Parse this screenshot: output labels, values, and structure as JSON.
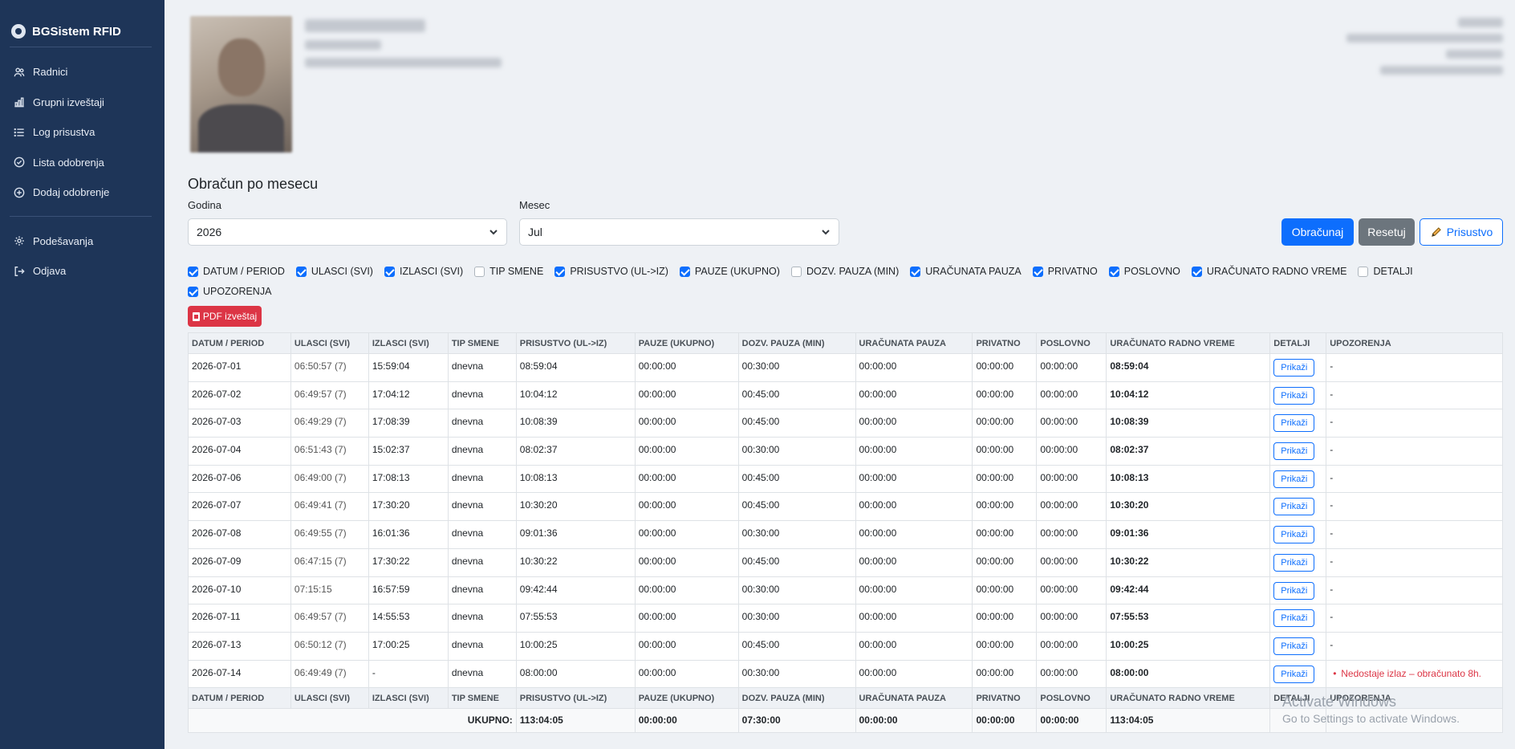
{
  "app": {
    "title": "BGSistem RFID"
  },
  "sidebar": {
    "items": [
      {
        "label": "Radnici",
        "icon": "users-icon"
      },
      {
        "label": "Grupni izveštaji",
        "icon": "bar-chart-icon"
      },
      {
        "label": "Log prisustva",
        "icon": "list-icon"
      },
      {
        "label": "Lista odobrenja",
        "icon": "check-circle-icon"
      },
      {
        "label": "Dodaj odobrenje",
        "icon": "plus-circle-icon"
      }
    ],
    "bottom_items": [
      {
        "label": "Podešavanja",
        "icon": "gear-icon"
      },
      {
        "label": "Odjava",
        "icon": "logout-icon"
      }
    ]
  },
  "section": {
    "title": "Obračun po mesecu"
  },
  "form": {
    "year_label": "Godina",
    "year_value": "2026",
    "month_label": "Mesec",
    "month_value": "Jul",
    "calculate": "Obračunaj",
    "reset": "Resetuj",
    "attendance": "Prisustvo"
  },
  "columns_toggle": [
    {
      "label": "DATUM / PERIOD",
      "checked": true
    },
    {
      "label": "ULASCI (SVI)",
      "checked": true
    },
    {
      "label": "IZLASCI (SVI)",
      "checked": true
    },
    {
      "label": "TIP SMENE",
      "checked": false
    },
    {
      "label": "PRISUSTVO (UL->IZ)",
      "checked": true
    },
    {
      "label": "PAUZE (UKUPNO)",
      "checked": true
    },
    {
      "label": "DOZV. PAUZA (MIN)",
      "checked": false
    },
    {
      "label": "URAČUNATA PAUZA",
      "checked": true
    },
    {
      "label": "PRIVATNO",
      "checked": true
    },
    {
      "label": "POSLOVNO",
      "checked": true
    },
    {
      "label": "URAČUNATO RADNO VREME",
      "checked": true
    },
    {
      "label": "DETALJI",
      "checked": false
    },
    {
      "label": "UPOZORENJA",
      "checked": true
    }
  ],
  "pdf_button": "PDF izveštaj",
  "table": {
    "headers": [
      "DATUM / PERIOD",
      "ULASCI (SVI)",
      "IZLASCI (SVI)",
      "TIP SMENE",
      "PRISUSTVO (UL->IZ)",
      "PAUZE (UKUPNO)",
      "DOZV. PAUZA (MIN)",
      "URAČUNATA PAUZA",
      "PRIVATNO",
      "POSLOVNO",
      "URAČUNATO RADNO VREME",
      "DETALJI",
      "UPOZORENJA"
    ],
    "details_label": "Prikaži",
    "rows": [
      [
        "2026-07-01",
        "06:50:57 (7)",
        "15:59:04",
        "dnevna",
        "08:59:04",
        "00:00:00",
        "00:30:00",
        "00:00:00",
        "00:00:00",
        "00:00:00",
        "08:59:04",
        "-"
      ],
      [
        "2026-07-02",
        "06:49:57 (7)",
        "17:04:12",
        "dnevna",
        "10:04:12",
        "00:00:00",
        "00:45:00",
        "00:00:00",
        "00:00:00",
        "00:00:00",
        "10:04:12",
        "-"
      ],
      [
        "2026-07-03",
        "06:49:29 (7)",
        "17:08:39",
        "dnevna",
        "10:08:39",
        "00:00:00",
        "00:45:00",
        "00:00:00",
        "00:00:00",
        "00:00:00",
        "10:08:39",
        "-"
      ],
      [
        "2026-07-04",
        "06:51:43 (7)",
        "15:02:37",
        "dnevna",
        "08:02:37",
        "00:00:00",
        "00:30:00",
        "00:00:00",
        "00:00:00",
        "00:00:00",
        "08:02:37",
        "-"
      ],
      [
        "2026-07-06",
        "06:49:00 (7)",
        "17:08:13",
        "dnevna",
        "10:08:13",
        "00:00:00",
        "00:45:00",
        "00:00:00",
        "00:00:00",
        "00:00:00",
        "10:08:13",
        "-"
      ],
      [
        "2026-07-07",
        "06:49:41 (7)",
        "17:30:20",
        "dnevna",
        "10:30:20",
        "00:00:00",
        "00:45:00",
        "00:00:00",
        "00:00:00",
        "00:00:00",
        "10:30:20",
        "-"
      ],
      [
        "2026-07-08",
        "06:49:55 (7)",
        "16:01:36",
        "dnevna",
        "09:01:36",
        "00:00:00",
        "00:30:00",
        "00:00:00",
        "00:00:00",
        "00:00:00",
        "09:01:36",
        "-"
      ],
      [
        "2026-07-09",
        "06:47:15 (7)",
        "17:30:22",
        "dnevna",
        "10:30:22",
        "00:00:00",
        "00:45:00",
        "00:00:00",
        "00:00:00",
        "00:00:00",
        "10:30:22",
        "-"
      ],
      [
        "2026-07-10",
        "07:15:15",
        "16:57:59",
        "dnevna",
        "09:42:44",
        "00:00:00",
        "00:30:00",
        "00:00:00",
        "00:00:00",
        "00:00:00",
        "09:42:44",
        "-"
      ],
      [
        "2026-07-11",
        "06:49:57 (7)",
        "14:55:53",
        "dnevna",
        "07:55:53",
        "00:00:00",
        "00:30:00",
        "00:00:00",
        "00:00:00",
        "00:00:00",
        "07:55:53",
        "-"
      ],
      [
        "2026-07-13",
        "06:50:12 (7)",
        "17:00:25",
        "dnevna",
        "10:00:25",
        "00:00:00",
        "00:45:00",
        "00:00:00",
        "00:00:00",
        "00:00:00",
        "10:00:25",
        "-"
      ],
      [
        "2026-07-14",
        "06:49:49 (7)",
        "-",
        "dnevna",
        "08:00:00",
        "00:00:00",
        "00:30:00",
        "00:00:00",
        "00:00:00",
        "00:00:00",
        "08:00:00",
        "Nedostaje izlaz – obračunato 8h."
      ]
    ],
    "total": {
      "label": "UKUPNO:",
      "values": [
        "113:04:05",
        "00:00:00",
        "07:30:00",
        "00:00:00",
        "00:00:00",
        "00:00:00",
        "113:04:05"
      ]
    }
  },
  "watermark": {
    "line1": "Activate Windows",
    "line2": "Go to Settings to activate Windows."
  }
}
